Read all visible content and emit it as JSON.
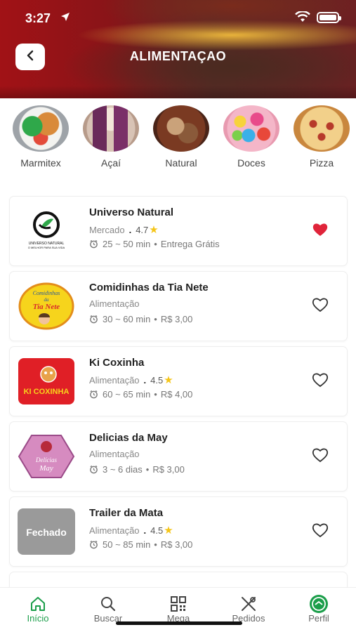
{
  "status_bar": {
    "time": "3:27"
  },
  "header": {
    "title": "ALIMENTAÇAO",
    "back_icon": "chevron-left-icon"
  },
  "categories": [
    {
      "label": "Marmitex"
    },
    {
      "label": "Açaí"
    },
    {
      "label": "Natural"
    },
    {
      "label": "Doces"
    },
    {
      "label": "Pizza"
    }
  ],
  "restaurants": [
    {
      "name": "Universo Natural",
      "category": "Mercado",
      "rating": "4.7",
      "time": "25 ~ 50 min",
      "fee": "Entrega Grátis",
      "favorite": true,
      "logo_tagline": "UNIVERSO NATURAL\nO MELHOR PARA SUA VIDA"
    },
    {
      "name": "Comidinhas da Tia Nete",
      "category": "Alimentação",
      "rating": null,
      "time": "30 ~ 60 min",
      "fee": "R$ 3,00",
      "favorite": false,
      "logo_text": "Comidinhas da Tia Nete"
    },
    {
      "name": "Ki Coxinha",
      "category": "Alimentação",
      "rating": "4.5",
      "time": "60 ~ 65 min",
      "fee": "R$ 4,00",
      "favorite": false,
      "logo_text": "KI COXINHA"
    },
    {
      "name": "Delicias da May",
      "category": "Alimentação",
      "rating": null,
      "time": "3 ~ 6 dias",
      "fee": "R$ 3,00",
      "favorite": false,
      "logo_text": "Delícias da May"
    },
    {
      "name": "Trailer da Mata",
      "category": "Alimentação",
      "rating": "4.5",
      "time": "50 ~ 85 min",
      "fee": "R$ 3,00",
      "favorite": false,
      "logo_text": "Fechado"
    }
  ],
  "tabbar": [
    {
      "label": "Início",
      "icon": "home-icon",
      "active": true
    },
    {
      "label": "Buscar",
      "icon": "search-icon",
      "active": false
    },
    {
      "label": "Mega",
      "icon": "qr-code-icon",
      "active": false
    },
    {
      "label": "Pedidos",
      "icon": "utensils-icon",
      "active": false
    },
    {
      "label": "Perfil",
      "icon": "profile-icon",
      "active": false
    }
  ],
  "colors": {
    "accent": "#1b9e4a",
    "heart_active": "#e0243a",
    "star": "#f5c518"
  }
}
